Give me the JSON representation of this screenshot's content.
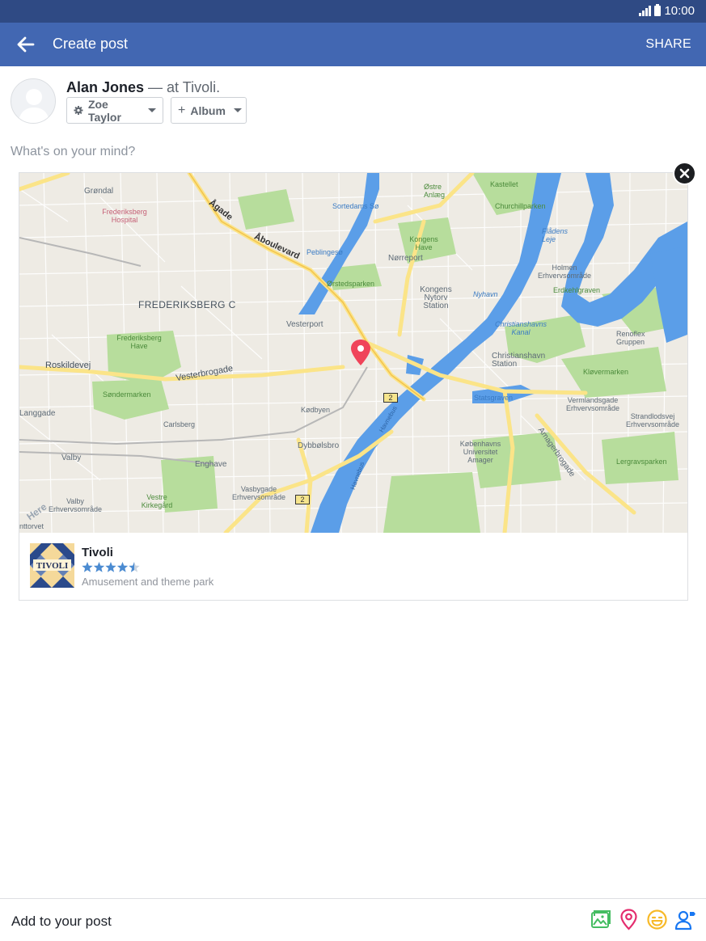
{
  "status_bar": {
    "time": "10:00"
  },
  "header": {
    "title": "Create post",
    "share_label": "SHARE"
  },
  "post": {
    "author": "Alan Jones",
    "location_prefix": "— at",
    "location": "Tivoli.",
    "audience_label": "Zoe Taylor",
    "album_label": "Album",
    "composer_placeholder": "What's on your mind?"
  },
  "map": {
    "labels": [
      "Grøndal",
      "Frederiksberg Hospital",
      "Ågade",
      "Åboulevard",
      "Sortedams Sø",
      "Østre Anlæg",
      "Kastellet",
      "Churchillparken",
      "Flådens Leje",
      "Peblingesø",
      "Kongens Have",
      "Nørreport",
      "Holmen Erhvervsområde",
      "Erdkehlgraven",
      "Ørstedsparken",
      "Kongens Nytorv Station",
      "Nyhavn",
      "FREDERIKSBERG C",
      "Vesterport",
      "Christianshavns Kanal",
      "Renoflex Gruppen",
      "Frederiksberg Have",
      "Roskildevej",
      "Christianshavn Station",
      "Kløvermarken",
      "Vesterbrogade",
      "Søndermarken",
      "Statsgraven",
      "Vermlandsgade Erhvervsområde",
      "Langgade",
      "Kødbyen",
      "Strandlodsvej Erhvervsområde",
      "Carlsberg",
      "Amagerbrogade",
      "Københavns Universitet Amager",
      "Valby",
      "Dybbølsbro",
      "Enghave",
      "Lergravsparken",
      "Vasbygade Erhvervsområde",
      "Vestre Kirkegård",
      "Valby Erhvervsområde",
      "nttorvet",
      "Here"
    ],
    "road_shields": [
      "2",
      "2",
      "2"
    ],
    "water_labels": [
      "Havnebus",
      "Havnebus"
    ]
  },
  "place": {
    "name": "Tivoli",
    "rating": 4.5,
    "category": "Amusement and theme park",
    "logo_text": "TIVOLI"
  },
  "footer": {
    "add_label": "Add to your post",
    "icons": [
      "photo-icon",
      "location-pin-icon",
      "feeling-icon",
      "tag-people-icon"
    ]
  },
  "colors": {
    "status_bar": "#2f4a84",
    "app_bar": "#4267b2",
    "map_pin": "#f0445a",
    "water": "#4a90e2",
    "park": "#a8da8c",
    "star": "#4b8bd1"
  }
}
